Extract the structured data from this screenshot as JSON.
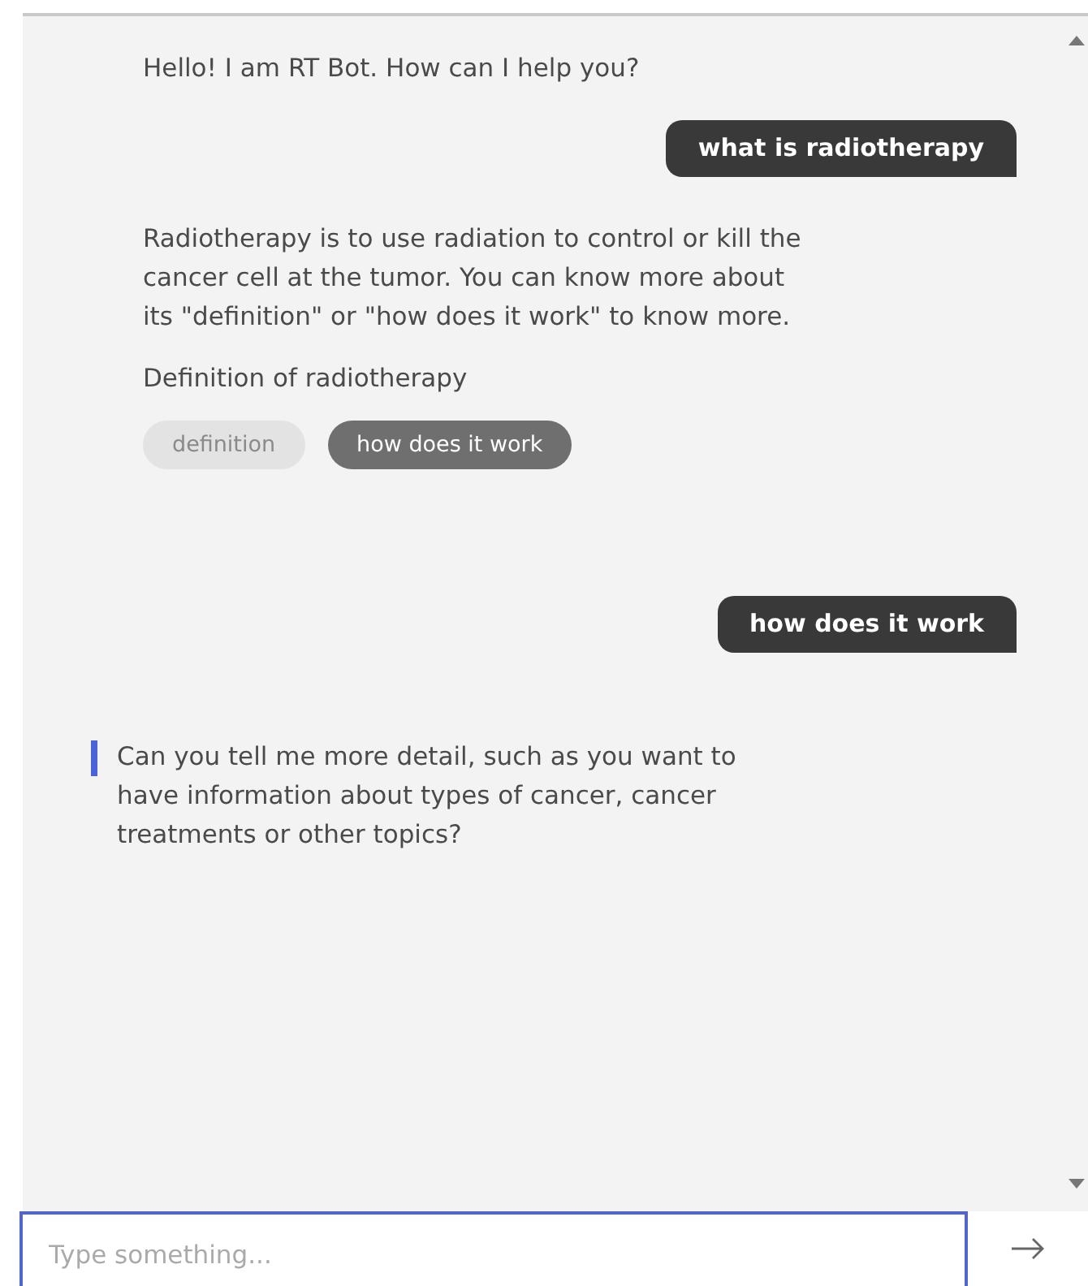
{
  "messages": [
    {
      "kind": "bot",
      "texts": [
        "Hello! I am RT Bot. How can I help you?"
      ],
      "focused": false
    },
    {
      "kind": "user",
      "texts": [
        "what is radiotherapy"
      ]
    },
    {
      "kind": "bot",
      "texts": [
        "Radiotherapy is to use radiation to control or kill the cancer cell at the tumor. You can know more about its \"definition\" or \"how does it work\" to know more.",
        "Definition of radiotherapy"
      ],
      "focused": false,
      "options": [
        {
          "label": "definition",
          "selected": false
        },
        {
          "label": "how does it work",
          "selected": true
        }
      ]
    },
    {
      "kind": "user",
      "texts": [
        "how does it work"
      ]
    },
    {
      "kind": "bot",
      "texts": [
        "Can you tell me more detail, such as you want to have information about types of cancer, cancer treatments or other topics?"
      ],
      "focused": true
    }
  ],
  "input": {
    "placeholder": "Type something..."
  }
}
